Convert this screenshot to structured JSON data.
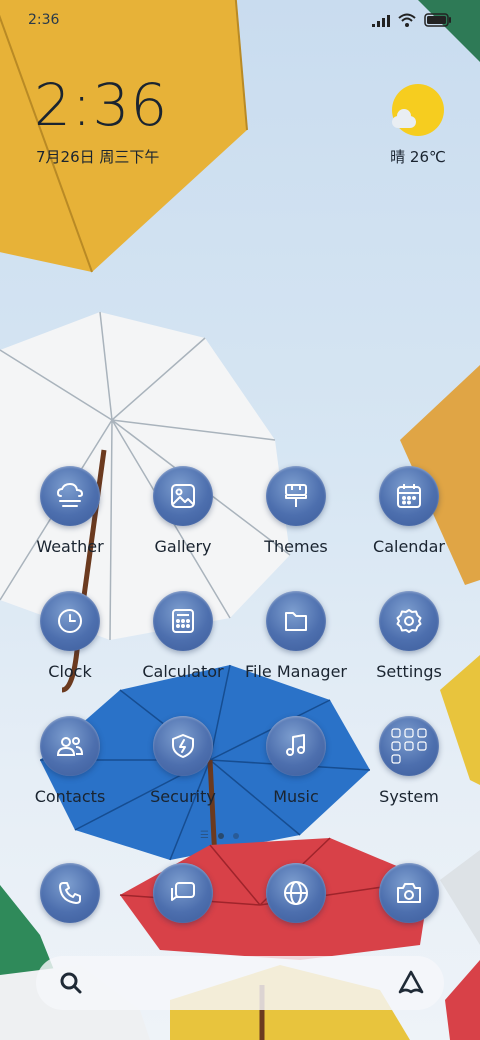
{
  "status_bar": {
    "time": "2:36"
  },
  "clock_widget": {
    "time": "2:36",
    "date": "7月26日 周三下午"
  },
  "weather_widget": {
    "condition": "晴",
    "temperature": "26℃"
  },
  "apps": [
    {
      "label": "Weather",
      "icon": "weather-icon"
    },
    {
      "label": "Gallery",
      "icon": "gallery-icon"
    },
    {
      "label": "Themes",
      "icon": "themes-icon"
    },
    {
      "label": "Calendar",
      "icon": "calendar-icon"
    },
    {
      "label": "Clock",
      "icon": "clock-icon"
    },
    {
      "label": "Calculator",
      "icon": "calculator-icon"
    },
    {
      "label": "File Manager",
      "icon": "folder-icon"
    },
    {
      "label": "Settings",
      "icon": "gear-icon"
    },
    {
      "label": "Contacts",
      "icon": "contacts-icon"
    },
    {
      "label": "Security",
      "icon": "shield-icon"
    },
    {
      "label": "Music",
      "icon": "music-icon"
    },
    {
      "label": "System",
      "icon": "folder-grid-icon"
    }
  ],
  "dock": [
    {
      "icon": "phone-icon"
    },
    {
      "icon": "messages-icon"
    },
    {
      "icon": "browser-icon"
    },
    {
      "icon": "camera-icon"
    }
  ],
  "page_indicator": {
    "pages": 2,
    "current": 1
  },
  "colors": {
    "icon_blue": "#4d6fae",
    "sun_yellow": "#f6cd1f",
    "sky": "#d7e6f3"
  }
}
